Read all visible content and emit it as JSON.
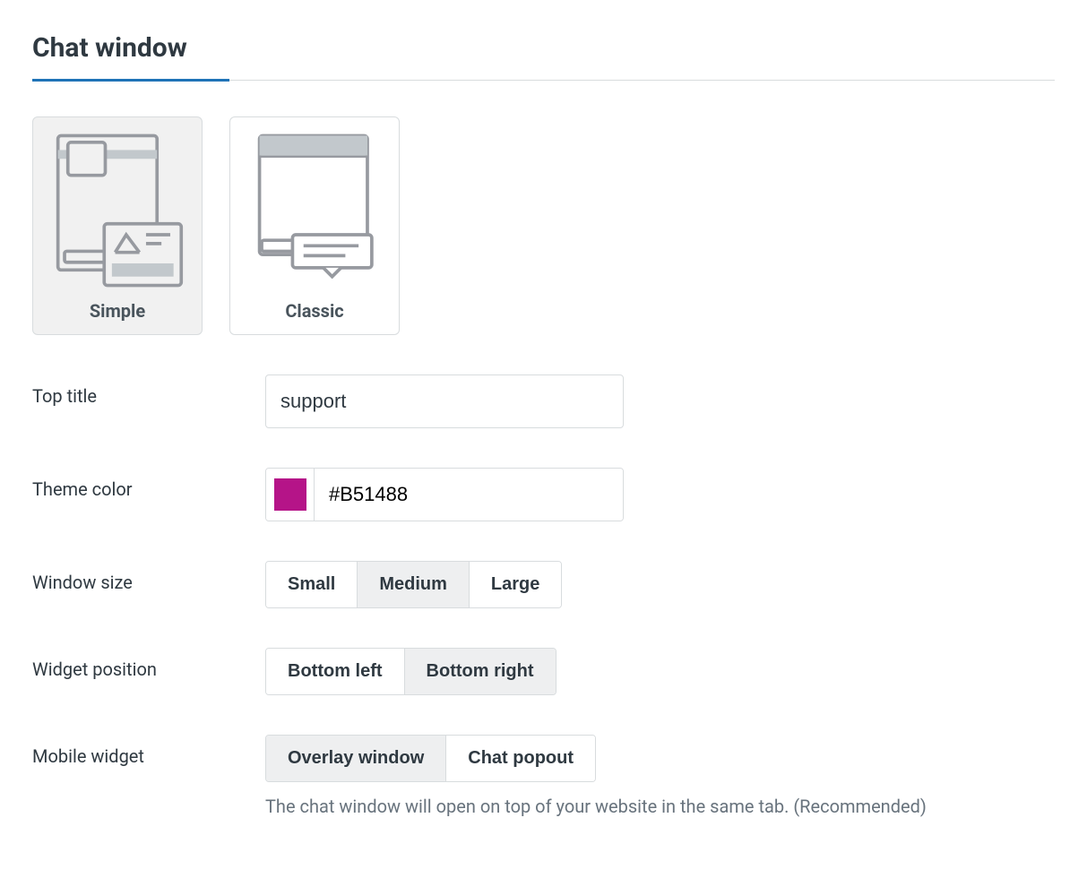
{
  "section": {
    "title": "Chat window"
  },
  "themes": {
    "simple": {
      "label": "Simple",
      "selected": true
    },
    "classic": {
      "label": "Classic",
      "selected": false
    }
  },
  "fields": {
    "top_title": {
      "label": "Top title",
      "value": "support"
    },
    "theme_color": {
      "label": "Theme color",
      "value": "#B51488",
      "swatch": "#B51488"
    },
    "window_size": {
      "label": "Window size",
      "options": [
        "Small",
        "Medium",
        "Large"
      ],
      "selected": "Medium"
    },
    "widget_position": {
      "label": "Widget position",
      "options": [
        "Bottom left",
        "Bottom right"
      ],
      "selected": "Bottom right"
    },
    "mobile_widget": {
      "label": "Mobile widget",
      "options": [
        "Overlay window",
        "Chat popout"
      ],
      "selected": "Overlay window",
      "help": "The chat window will open on top of your website in the same tab. (Recommended)"
    }
  }
}
